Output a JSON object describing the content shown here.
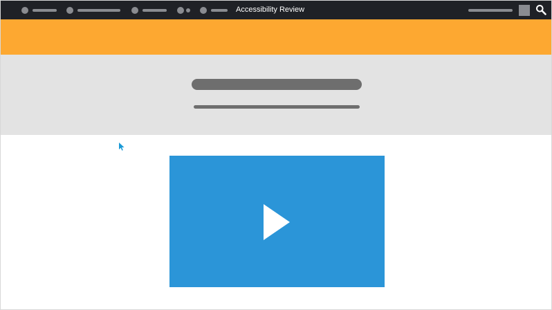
{
  "topbar": {
    "title": "Accessibility Review",
    "nav_items": [
      {
        "name": "nav-item-1"
      },
      {
        "name": "nav-item-2"
      },
      {
        "name": "nav-item-3"
      },
      {
        "name": "nav-item-4"
      },
      {
        "name": "nav-item-5"
      }
    ],
    "icons": {
      "search": "search-icon",
      "avatar": "avatar-placeholder"
    }
  },
  "colors": {
    "topbar": "#1f2126",
    "placeholder": "#8a8c91",
    "banner": "#fda831",
    "hero": "#e3e3e3",
    "hero_text_placeholder": "#6e6e6e",
    "video": "#2b95d8",
    "cursor": "#1a9ad6"
  },
  "video": {
    "icon": "play-icon"
  },
  "cursor": {
    "icon": "mouse-pointer-icon"
  }
}
